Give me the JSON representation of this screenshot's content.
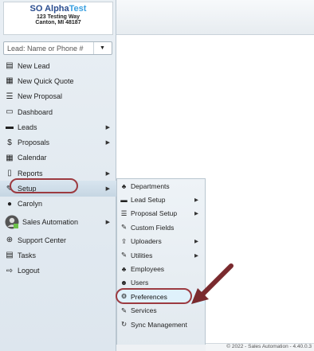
{
  "brand": {
    "name_part1": "SO Alpha",
    "name_part2": "Test",
    "address_line1": "123 Testing Way",
    "address_line2": "Canton, MI 48187"
  },
  "lead_search": {
    "placeholder": "Lead: Name or Phone #"
  },
  "nav": {
    "items": [
      {
        "label": "New Lead",
        "icon": "id-card-icon"
      },
      {
        "label": "New Quick Quote",
        "icon": "calculator-icon"
      },
      {
        "label": "New Proposal",
        "icon": "list-icon"
      },
      {
        "label": "Dashboard",
        "icon": "dashboard-icon"
      },
      {
        "label": "Leads",
        "icon": "briefcase-icon"
      },
      {
        "label": "Proposals",
        "icon": "dollar-icon"
      },
      {
        "label": "Calendar",
        "icon": "calendar-icon"
      },
      {
        "label": "Reports",
        "icon": "document-icon"
      },
      {
        "label": "Setup",
        "icon": "wrench-icon"
      },
      {
        "label": "Carolyn",
        "icon": "user-icon"
      },
      {
        "label": "Sales Automation",
        "icon": "avatar-icon"
      },
      {
        "label": "Support Center",
        "icon": "lifebuoy-icon"
      },
      {
        "label": "Tasks",
        "icon": "tasks-icon"
      },
      {
        "label": "Logout",
        "icon": "logout-icon"
      }
    ]
  },
  "submenu": {
    "items": [
      {
        "label": "Departments",
        "icon": "sitemap-icon"
      },
      {
        "label": "Lead Setup",
        "icon": "briefcase-icon"
      },
      {
        "label": "Proposal Setup",
        "icon": "list-icon"
      },
      {
        "label": "Custom Fields",
        "icon": "pencil-icon"
      },
      {
        "label": "Uploaders",
        "icon": "upload-icon"
      },
      {
        "label": "Utilities",
        "icon": "wrench-icon"
      },
      {
        "label": "Employees",
        "icon": "sitemap-icon"
      },
      {
        "label": "Users",
        "icon": "users-icon"
      },
      {
        "label": "Preferences",
        "icon": "gears-icon"
      },
      {
        "label": "Services",
        "icon": "wrench-icon"
      },
      {
        "label": "Sync Management",
        "icon": "refresh-icon"
      }
    ]
  },
  "footer": {
    "text": "© 2022 - Sales Automation - 4.40.0.3"
  },
  "colors": {
    "brand_dark": "#2a4d8f",
    "brand_accent": "#3aa0e0",
    "highlight_oval": "#9c3a40",
    "annotation_arrow": "#7a2a2e",
    "selected_bg": "#dff1fb"
  }
}
